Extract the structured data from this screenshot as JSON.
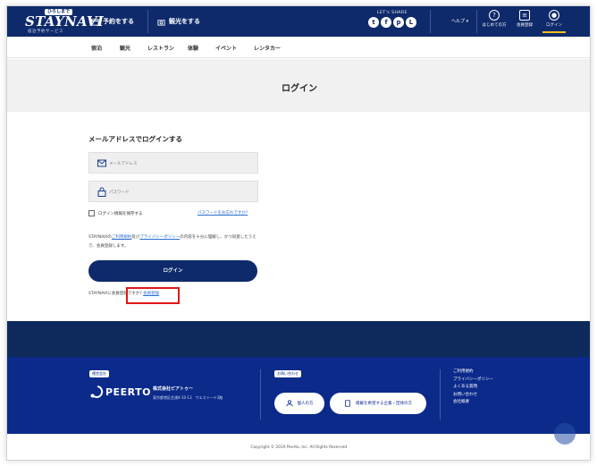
{
  "header": {
    "logo_badge": "ひろしまで",
    "logo_text": "STAYNAVI",
    "logo_sub": "宿泊予約サービス",
    "nav_book": "予約をする",
    "nav_sightseeing": "観光をする",
    "share_label": "LET's SHARE",
    "share_icons": [
      "twitter",
      "facebook",
      "pinterest",
      "line"
    ],
    "help_label": "ヘルプ ▾",
    "guide_label": "はじめての方",
    "register_label": "会員登録",
    "login_label": "ログイン",
    "accent": "#f2c21b",
    "brand_color": "#0e2a6b"
  },
  "subnav": [
    "宿泊",
    "観光",
    "レストラン",
    "体験",
    "イベント",
    "レンタカー"
  ],
  "page_title": "ログイン",
  "form": {
    "heading": "メールアドレスでログインする",
    "email_placeholder": "メールアドレス",
    "password_placeholder": "パスワード",
    "remember_label": "ログイン情報を保存する",
    "forgot_link": "パスワードをお忘れですか?",
    "terms_prefix": "STAYNAVIの",
    "terms_link": "ご利用規約",
    "terms_mid": "及び",
    "privacy_link": "プライバシーポリシー",
    "terms_suffix": "の内容を十分に理解し、かつ同意したうえで、会員登録します。",
    "login_button": "ログイン",
    "register_prefix": "STAYNAVIに会員登録ですか?",
    "register_link": "会員登録"
  },
  "footer": {
    "operator_tag": "運営会社",
    "company_logo": "PEERTO",
    "company_name": "株式会社ピアトゥー",
    "address": "東京都港区芝浦4-10-13　ワエスト―ド3階",
    "contact_tag": "お問い合わせ",
    "contact_individual": "個人の方",
    "contact_corporate": "掲載を希望する企業・団体の方",
    "links": [
      "ご利用規約",
      "プライバシーポリシー",
      "よくある質問",
      "お問い合わせ",
      "会社概要"
    ],
    "copyright": "Copyright © 2019 Peerto, Inc. All Rights Reserved."
  }
}
